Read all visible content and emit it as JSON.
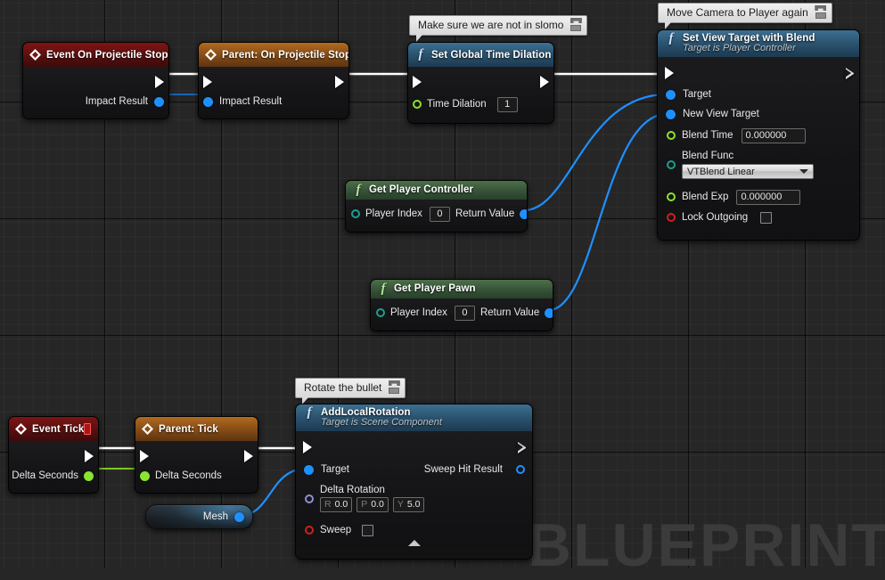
{
  "canvas": {
    "watermark": "BLUEPRINT",
    "background_color": "#262626",
    "grid_minor_color": "#2e2e2e",
    "grid_major_color": "#121212"
  },
  "comments": [
    {
      "id": "comment-slomo",
      "text": "Make sure we are not in slomo"
    },
    {
      "id": "comment-camera",
      "text": "Move Camera to Player again"
    },
    {
      "id": "comment-rotate",
      "text": "Rotate the bullet"
    }
  ],
  "nodes": {
    "event_on_projectile_stop": {
      "title": "Event On Projectile Stop",
      "type": "event",
      "header_color": "#7d1414",
      "out_data_pin": "Impact Result"
    },
    "parent_on_projectile_stop": {
      "title": "Parent: On Projectile Stop",
      "type": "parent",
      "header_color": "#8a4f17",
      "in_data_pin": "Impact Result"
    },
    "set_global_time_dilation": {
      "title": "Set Global Time Dilation",
      "type": "function",
      "header_color": "#2c5572",
      "input_label": "Time Dilation",
      "input_value": "1"
    },
    "set_view_target_with_blend": {
      "title": "Set View Target with Blend",
      "subtitle": "Target is Player Controller",
      "type": "function",
      "header_color": "#2c5572",
      "pins": {
        "target": "Target",
        "new_view_target": "New View Target",
        "blend_time_label": "Blend Time",
        "blend_time_value": "0.000000",
        "blend_func_label": "Blend Func",
        "blend_func_value": "VTBlend Linear",
        "blend_exp_label": "Blend Exp",
        "blend_exp_value": "0.000000",
        "lock_outgoing_label": "Lock Outgoing",
        "lock_outgoing_checked": false
      }
    },
    "get_player_controller": {
      "title": "Get Player Controller",
      "type": "pure",
      "header_color": "#39553a",
      "input_label": "Player Index",
      "input_value": "0",
      "output_label": "Return Value"
    },
    "get_player_pawn": {
      "title": "Get Player Pawn",
      "type": "pure",
      "header_color": "#39553a",
      "input_label": "Player Index",
      "input_value": "0",
      "output_label": "Return Value"
    },
    "event_tick": {
      "title": "Event Tick",
      "type": "event",
      "header_color": "#7d1414",
      "out_data_pin": "Delta Seconds"
    },
    "parent_tick": {
      "title": "Parent: Tick",
      "type": "parent",
      "header_color": "#8a4f17",
      "in_data_pin": "Delta Seconds"
    },
    "mesh_variable": {
      "title": "Mesh"
    },
    "add_local_rotation": {
      "title": "AddLocalRotation",
      "subtitle": "Target is Scene Component",
      "type": "function",
      "header_color": "#2c5572",
      "pins": {
        "target": "Target",
        "sweep_hit_result": "Sweep Hit Result",
        "delta_rotation_label": "Delta Rotation",
        "delta_rotation": {
          "roll_axis": "R",
          "roll": "0.0",
          "pitch_axis": "P",
          "pitch": "0.0",
          "yaw_axis": "Y",
          "yaw": "5.0"
        },
        "sweep_label": "Sweep",
        "sweep_checked": false
      }
    }
  },
  "wire_colors": {
    "exec": "#ffffff",
    "object": "#1e90ff",
    "float": "#8ae32e"
  }
}
